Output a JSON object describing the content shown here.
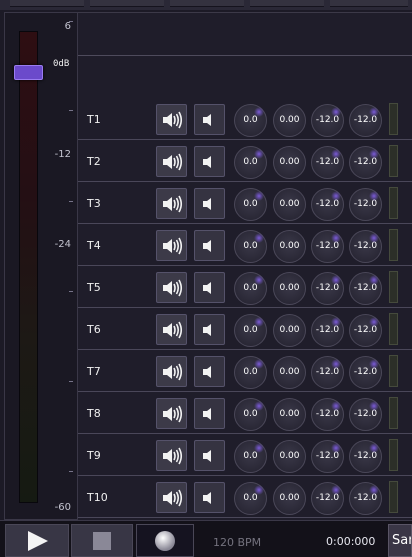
{
  "master": {
    "scale": [
      "6",
      "-12",
      "-24",
      "-60"
    ],
    "knob_label": "0dB",
    "fader_level_db": 0
  },
  "tracks": [
    {
      "name": "T1",
      "v1": "0.0",
      "v2": "0.00",
      "v3": "-12.0",
      "v4": "-12.0"
    },
    {
      "name": "T2",
      "v1": "0.0",
      "v2": "0.00",
      "v3": "-12.0",
      "v4": "-12.0"
    },
    {
      "name": "T3",
      "v1": "0.0",
      "v2": "0.00",
      "v3": "-12.0",
      "v4": "-12.0"
    },
    {
      "name": "T4",
      "v1": "0.0",
      "v2": "0.00",
      "v3": "-12.0",
      "v4": "-12.0"
    },
    {
      "name": "T5",
      "v1": "0.0",
      "v2": "0.00",
      "v3": "-12.0",
      "v4": "-12.0"
    },
    {
      "name": "T6",
      "v1": "0.0",
      "v2": "0.00",
      "v3": "-12.0",
      "v4": "-12.0"
    },
    {
      "name": "T7",
      "v1": "0.0",
      "v2": "0.00",
      "v3": "-12.0",
      "v4": "-12.0"
    },
    {
      "name": "T8",
      "v1": "0.0",
      "v2": "0.00",
      "v3": "-12.0",
      "v4": "-12.0"
    },
    {
      "name": "T9",
      "v1": "0.0",
      "v2": "0.00",
      "v3": "-12.0",
      "v4": "-12.0"
    },
    {
      "name": "T10",
      "v1": "0.0",
      "v2": "0.00",
      "v3": "-12.0",
      "v4": "-12.0"
    }
  ],
  "transport": {
    "bpm": "120 BPM",
    "time": "0:00:000",
    "sample_button": "Sam"
  },
  "colors": {
    "accent": "#6b4acb",
    "background": "#1c1a26"
  },
  "icons": {
    "mute": "speaker-mute-icon",
    "solo": "speaker-solo-icon",
    "play": "play-icon",
    "stop": "stop-icon",
    "record": "record-icon"
  }
}
